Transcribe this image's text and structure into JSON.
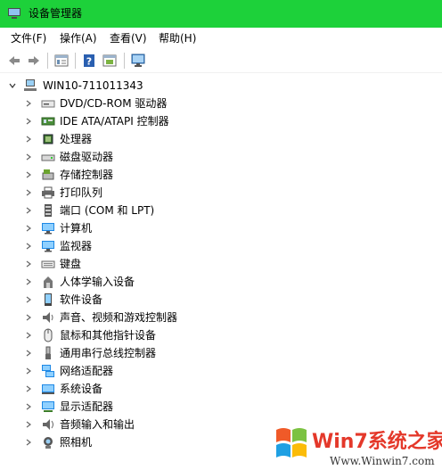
{
  "window": {
    "title": "设备管理器"
  },
  "menu": {
    "items": [
      "文件(F)",
      "操作(A)",
      "查看(V)",
      "帮助(H)"
    ]
  },
  "toolbar": {
    "buttons": [
      "back-icon",
      "forward-icon",
      "properties-icon",
      "help-icon",
      "show-hidden-icon",
      "monitor-icon"
    ]
  },
  "tree": {
    "root": "WIN10-711011343",
    "categories": [
      "DVD/CD-ROM 驱动器",
      "IDE ATA/ATAPI 控制器",
      "处理器",
      "磁盘驱动器",
      "存储控制器",
      "打印队列",
      "端口 (COM 和 LPT)",
      "计算机",
      "监视器",
      "键盘",
      "人体学输入设备",
      "软件设备",
      "声音、视频和游戏控制器",
      "鼠标和其他指针设备",
      "通用串行总线控制器",
      "网络适配器",
      "系统设备",
      "显示适配器",
      "音频输入和输出",
      "照相机"
    ]
  },
  "watermark": {
    "brand": "Win7系统之家",
    "url": "Www.Winwin7.com"
  }
}
